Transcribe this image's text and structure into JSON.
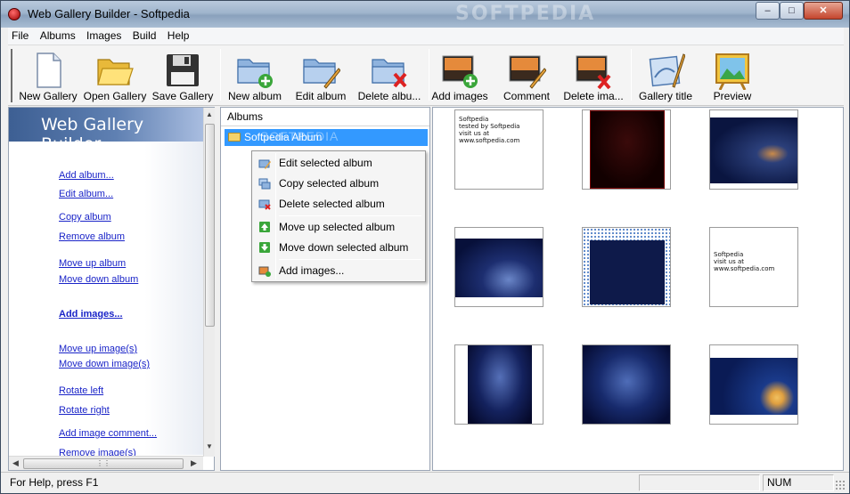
{
  "window": {
    "title": "Web Gallery Builder - Softpedia",
    "watermark": "SOFTPEDIA"
  },
  "menu": [
    "File",
    "Albums",
    "Images",
    "Build",
    "Help"
  ],
  "toolbar": {
    "new_gallery": "New Gallery",
    "open_gallery": "Open Gallery",
    "save_gallery": "Save Gallery",
    "new_album": "New album",
    "edit_album": "Edit album",
    "delete_album": "Delete albu...",
    "add_images": "Add images",
    "comment": "Comment",
    "delete_image": "Delete ima...",
    "gallery_title": "Gallery title",
    "preview": "Preview"
  },
  "left_panel": {
    "header": "Web Gallery Builder",
    "tasks": [
      "Add album...",
      "Edit album...",
      "Copy album",
      "Remove album",
      "Move up album",
      "Move down album",
      "Add images...",
      "Move up image(s)",
      "Move down image(s)",
      "Rotate left",
      "Rotate right",
      "Add image comment...",
      "Remove image(s)"
    ]
  },
  "albums": {
    "header": "Albums",
    "items": [
      "Softpedia Album"
    ],
    "item_watermark": "SOFTPEDIA"
  },
  "context_menu": [
    "Edit selected album",
    "Copy selected album",
    "Delete selected album",
    "Move up selected album",
    "Move down selected album",
    "Add images..."
  ],
  "thumb_text": {
    "line1": "Softpedia",
    "line2": "tested by Softpedia",
    "line3": "visit us at www.softpedia.com"
  },
  "status": {
    "help": "For Help, press F1",
    "num": "NUM"
  }
}
